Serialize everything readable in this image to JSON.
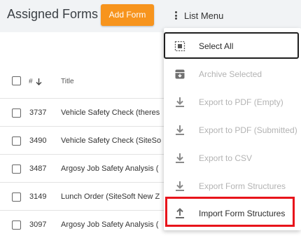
{
  "header": {
    "title": "Assigned Forms",
    "add_form_label": "Add Form",
    "list_menu_label": "List Menu"
  },
  "table": {
    "columns": {
      "number": "#",
      "title": "Title"
    },
    "sort_indicator": "arrow-down-icon",
    "rows": [
      {
        "number": "3737",
        "title": "Vehicle Safety Check (theres"
      },
      {
        "number": "3490",
        "title": "Vehicle Safety Check (SiteSo"
      },
      {
        "number": "3487",
        "title": "Argosy Job Safety Analysis ("
      },
      {
        "number": "3149",
        "title": "Lunch Order (SiteSoft New Z"
      },
      {
        "number": "3097",
        "title": "Argosy Job Safety Analysis ("
      }
    ]
  },
  "menu": {
    "items": [
      {
        "label": "Select All",
        "icon": "select-all-icon",
        "enabled": true
      },
      {
        "label": "Archive Selected",
        "icon": "archive-icon",
        "enabled": false
      },
      {
        "label": "Export to PDF (Empty)",
        "icon": "download-icon",
        "enabled": false
      },
      {
        "label": "Export to PDF (Submitted)",
        "icon": "download-icon",
        "enabled": false
      },
      {
        "label": "Export to CSV",
        "icon": "download-icon",
        "enabled": false
      },
      {
        "label": "Export Form Structures",
        "icon": "download-icon",
        "enabled": false
      },
      {
        "label": "Import Form Structures",
        "icon": "upload-icon",
        "enabled": true
      }
    ]
  },
  "colors": {
    "accent": "#f7941d",
    "highlight": "#e8141b",
    "header_bg": "#f1f3f5"
  }
}
